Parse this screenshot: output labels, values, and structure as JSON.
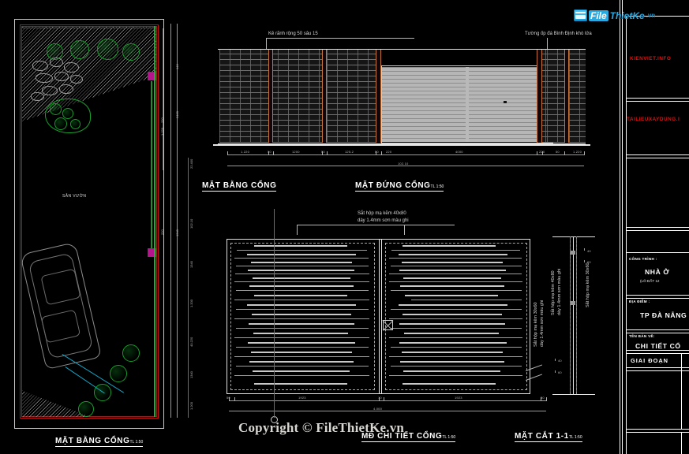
{
  "app": {
    "background": "#000000",
    "watermark": "Copyright © FileThietKe.vn",
    "logo": {
      "file": "File",
      "thietke": "ThietKe",
      "vn": ".vn"
    }
  },
  "drawing_titles": {
    "plan_gate_top": "MẶT BẰNG CỔNG",
    "elevation_gate": "MẶT ĐỨNG CỔNG",
    "elevation_gate_scale": "TL 1:50",
    "plan_gate_bottom": "MẶT BẰNG CỔNG",
    "plan_gate_bottom_scale": "TL 1:50",
    "detail_gate": "MĐ CHI TIẾT CỔNG",
    "detail_gate_scale": "TL 1:50",
    "section": "MẶT CẮT  1-1",
    "section_scale": "TL 1:50"
  },
  "annotations": {
    "groove": "Kẻ rãnh rộng 50 sâu 15",
    "stone_wall": "Tường ốp đá Bình Định khò lửa",
    "steel_box_40x80_l1": "Sắt hộp mạ kẽm 40x80",
    "steel_box_40x80_l2": "dày 1.4mm sơn màu ghi",
    "steel_box_30x60_l1": "Sắt hộp mạ kẽm 30x60",
    "steel_box_30x60_l2": "dày 1.4mm sơn màu ghi",
    "garden": "SÂN VƯỜN"
  },
  "dimensions": {
    "elevation_chain": [
      "1.220",
      "50",
      "1200",
      "50",
      "125.2",
      "50",
      "220",
      "4000",
      "220",
      "50",
      "1.220"
    ],
    "elevation_total": "102.10",
    "detail_chain": [
      "50",
      "1923",
      "10",
      "1923",
      "50"
    ],
    "detail_total": "4.000",
    "elevation_vertical": [
      "140",
      "2400",
      "1240"
    ],
    "plan_vertical_left": [
      "220",
      "1.220",
      "220"
    ],
    "plan_vertical_right": [
      "22.400",
      "102.10",
      "1340",
      "1.200",
      "40.220",
      "1340",
      "1.200"
    ],
    "section_vertical": [
      "40",
      "60",
      "40",
      "60",
      "40",
      "60"
    ]
  },
  "title_block": {
    "watermark_1": "KIENVIET.INFO",
    "watermark_2": "TAILIEUXAYDUNG.I",
    "project_label": "CÔNG TRÌNH :",
    "project_value": "NHÀ Ở",
    "project_sub": "(LÔ ĐẤT 12",
    "location_label": "ĐỊA ĐIỂM :",
    "location_value": "TP ĐÀ NẴNG",
    "sheet_label": "TÊN BẢN VẼ:",
    "sheet_value": "CHI TIẾT CỔ",
    "stage_label": "GIAI ĐOẠN"
  }
}
